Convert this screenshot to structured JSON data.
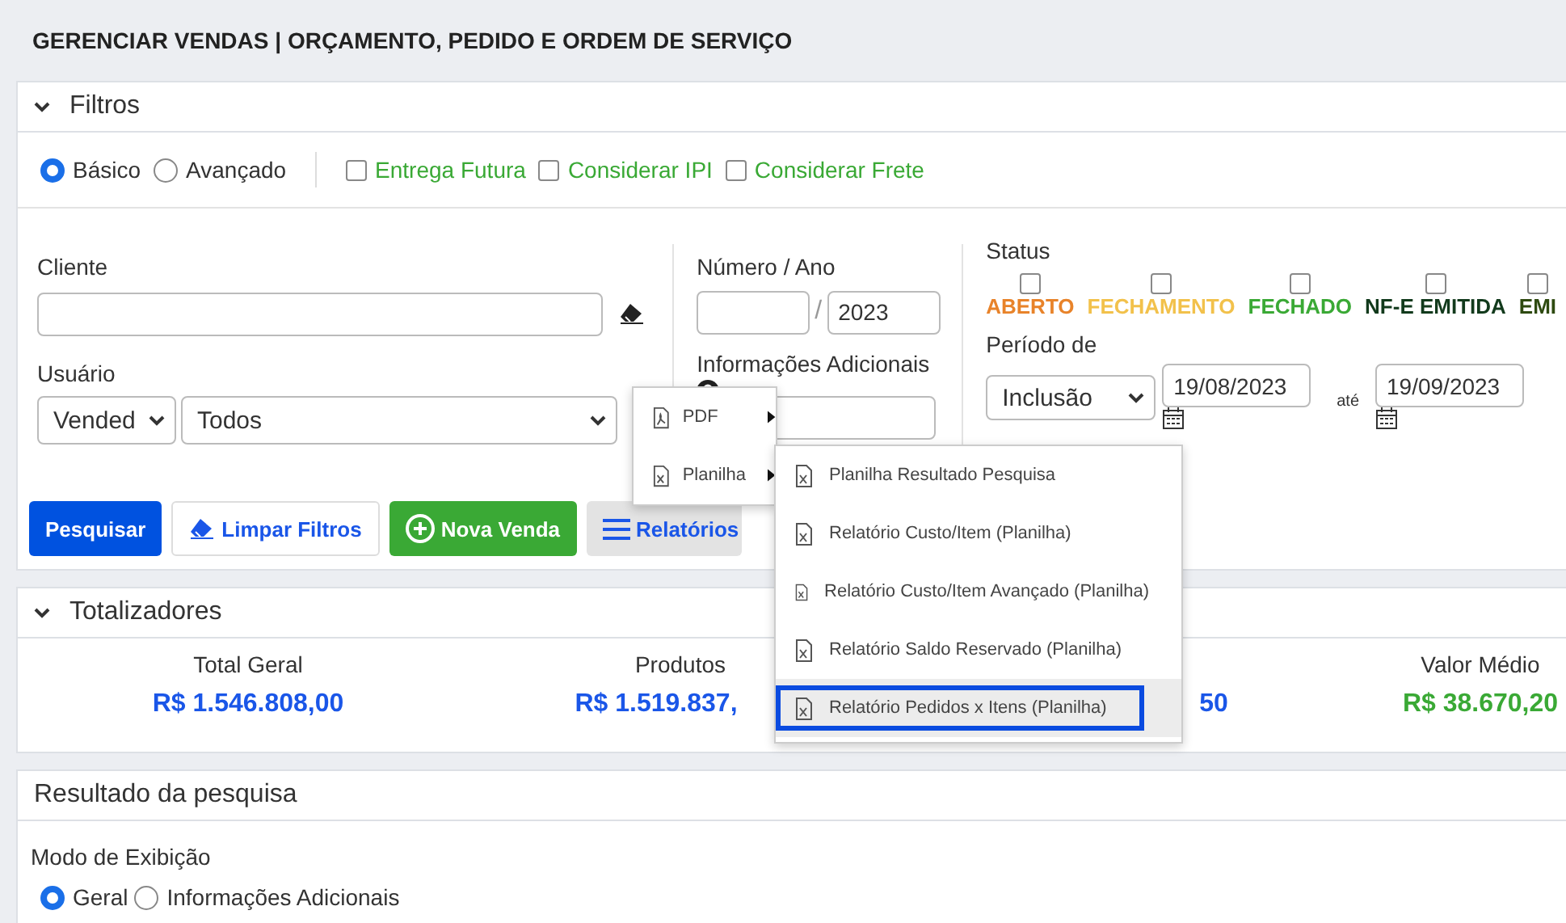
{
  "title": "GERENCIAR VENDAS | ORÇAMENTO, PEDIDO E ORDEM DE SERVIÇO",
  "filters": {
    "header": "Filtros",
    "expanded": true,
    "modes": [
      {
        "label": "Básico",
        "selected": true
      },
      {
        "label": "Avançado",
        "selected": false
      }
    ],
    "options": [
      {
        "label": "Entrega Futura",
        "checked": false
      },
      {
        "label": "Considerar IPI",
        "checked": false
      },
      {
        "label": "Considerar Frete",
        "checked": false
      }
    ],
    "cliente_label": "Cliente",
    "usuario_label": "Usuário",
    "usuario_type": "Vended",
    "usuario_value": "Todos",
    "numero_label": "Número / Ano",
    "numero_sep": "/",
    "ano": "2023",
    "info_label": "Informações Adicionais",
    "status_label": "Status",
    "statuses": [
      {
        "label": "ABERTO",
        "checked": false,
        "color": "#e8832a"
      },
      {
        "label": "FECHAMENTO",
        "checked": false,
        "color": "#f2c14b"
      },
      {
        "label": "FECHADO",
        "checked": false,
        "color": "#3aa935"
      },
      {
        "label": "NF-E EMITIDA",
        "checked": false,
        "color": "#123a1c"
      },
      {
        "label": "EMI",
        "checked": false,
        "color": "#2e4a10"
      }
    ],
    "periodo_label": "Período de",
    "periodo_value": "Inclusão",
    "date_from": "19/08/2023",
    "ate": "até",
    "date_to": "19/09/2023"
  },
  "buttons": [
    {
      "kind": "primary",
      "label": "Pesquisar"
    },
    {
      "kind": "clear",
      "label": "Limpar Filtros"
    },
    {
      "kind": "new",
      "label": "Nova Venda"
    },
    {
      "kind": "menu",
      "label": "Relatórios"
    }
  ],
  "menu": {
    "items": [
      {
        "kind": "pdf",
        "label": "PDF"
      },
      {
        "kind": "sheet",
        "label": "Planilha"
      }
    ],
    "submenu": [
      {
        "label": "Planilha Resultado Pesquisa",
        "selected": false
      },
      {
        "label": "Relatório Custo/Item (Planilha)",
        "selected": false
      },
      {
        "label": "Relatório Custo/Item Avançado (Planilha)",
        "selected": false
      },
      {
        "label": "Relatório Saldo Reservado (Planilha)",
        "selected": false
      },
      {
        "label": "Relatório Pedidos x Itens (Planilha)",
        "selected": true
      }
    ]
  },
  "totals": {
    "header": "Totalizadores",
    "expanded": true,
    "items": [
      {
        "label": "Total Geral",
        "value": "R$ 1.546.808,00",
        "color": "#1a56e8"
      },
      {
        "label": "Produtos",
        "value": "R$ 1.519.837,",
        "color": "#1a56e8"
      },
      {
        "value": "50",
        "color": "#1a56e8"
      },
      {
        "label": "Valor Médio",
        "value": "R$ 38.670,20",
        "color": "#3aa935"
      }
    ]
  },
  "result": {
    "header": "Resultado da pesquisa",
    "mode_label": "Modo de Exibição",
    "modes": [
      {
        "label": "Geral",
        "selected": true
      },
      {
        "label": "Informações Adicionais",
        "selected": false
      }
    ]
  }
}
